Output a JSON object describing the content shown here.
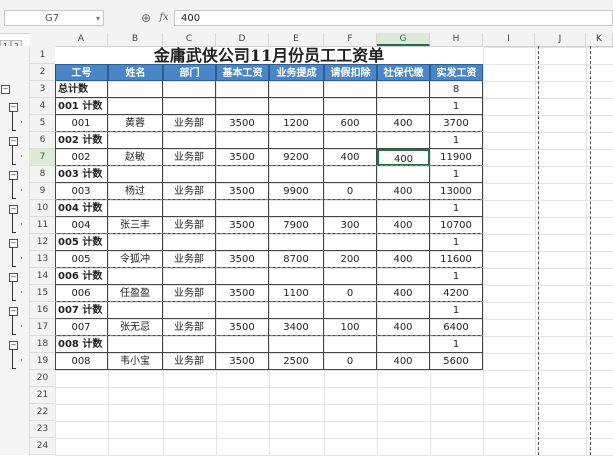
{
  "formula_bar": {
    "cell_ref": "G7",
    "zoom_icon": "zoom-icon",
    "fx_label": "fx",
    "value": "400"
  },
  "outline_levels": [
    "1",
    "2",
    "3"
  ],
  "columns": [
    "A",
    "B",
    "C",
    "D",
    "E",
    "F",
    "G",
    "H",
    "I",
    "J",
    "K"
  ],
  "active_column": "G",
  "active_row": "7",
  "rows": [
    "1",
    "2",
    "3",
    "4",
    "5",
    "6",
    "7",
    "8",
    "9",
    "10",
    "11",
    "12",
    "13",
    "14",
    "15",
    "16",
    "17",
    "18",
    "19",
    "20",
    "21",
    "22",
    "23",
    "24"
  ],
  "title": "金庸武侠公司11月份员工工资单",
  "headers": [
    "工号",
    "姓名",
    "部门",
    "基本工资",
    "业务提成",
    "请假扣除",
    "社保代缴",
    "实发工资"
  ],
  "total": {
    "label": "总计数",
    "count": "8"
  },
  "groups": [
    {
      "label": "001 计数",
      "count": "1",
      "row": [
        "001",
        "黄蓉",
        "业务部",
        "3500",
        "1200",
        "600",
        "400",
        "3700"
      ]
    },
    {
      "label": "002 计数",
      "count": "1",
      "row": [
        "002",
        "赵敏",
        "业务部",
        "3500",
        "9200",
        "400",
        "400",
        "11900"
      ]
    },
    {
      "label": "003 计数",
      "count": "1",
      "row": [
        "003",
        "杨过",
        "业务部",
        "3500",
        "9900",
        "0",
        "400",
        "13000"
      ]
    },
    {
      "label": "004 计数",
      "count": "1",
      "row": [
        "004",
        "张三丰",
        "业务部",
        "3500",
        "7900",
        "300",
        "400",
        "10700"
      ]
    },
    {
      "label": "005 计数",
      "count": "1",
      "row": [
        "005",
        "令狐冲",
        "业务部",
        "3500",
        "8700",
        "200",
        "400",
        "11600"
      ]
    },
    {
      "label": "006 计数",
      "count": "1",
      "row": [
        "006",
        "任盈盈",
        "业务部",
        "3500",
        "1100",
        "0",
        "400",
        "4200"
      ]
    },
    {
      "label": "007 计数",
      "count": "1",
      "row": [
        "007",
        "张无忌",
        "业务部",
        "3500",
        "3400",
        "100",
        "400",
        "6400"
      ]
    },
    {
      "label": "008 计数",
      "count": "1",
      "row": [
        "008",
        "韦小宝",
        "业务部",
        "3500",
        "2500",
        "0",
        "400",
        "5600"
      ]
    }
  ],
  "colors": {
    "header_bg": "#4a86c6",
    "header_text": "#ffffff",
    "selection": "#217346"
  }
}
